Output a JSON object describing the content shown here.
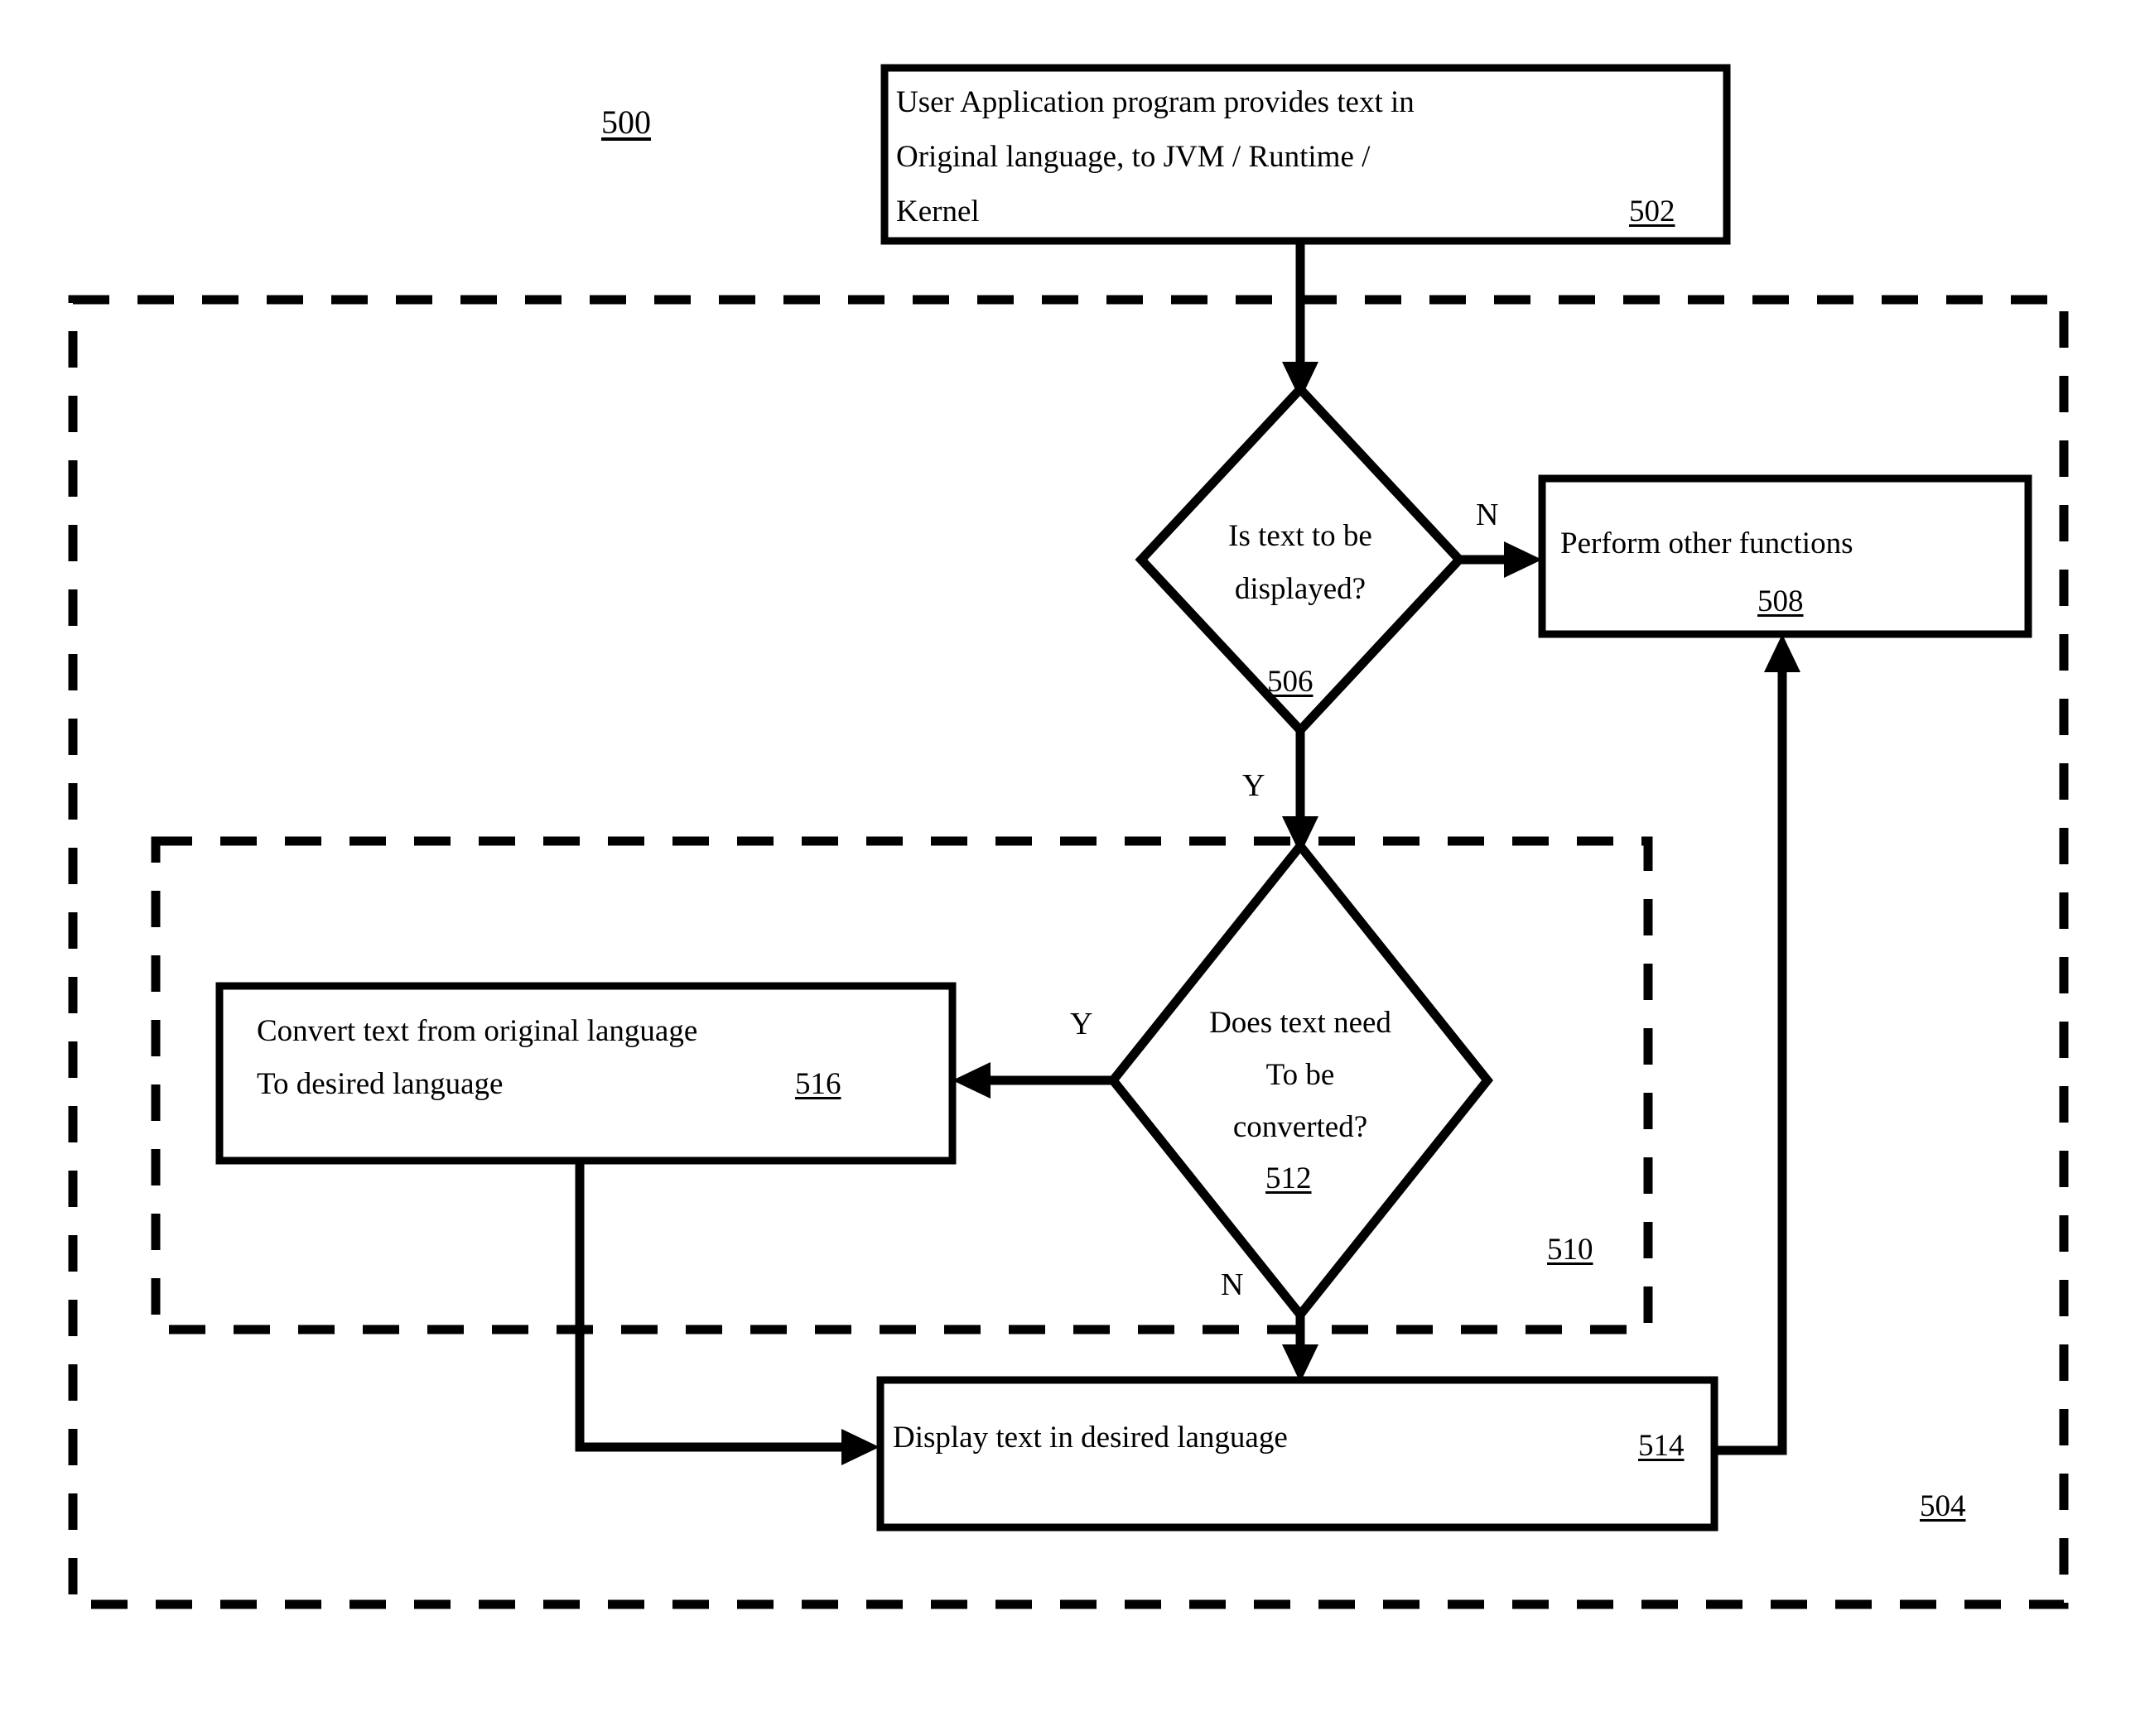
{
  "figure": {
    "id_label": "500",
    "outer_group_label": "504",
    "inner_group_label": "510"
  },
  "nodes": [
    {
      "key": "start",
      "type": "process",
      "ref": "502",
      "lines": [
        "User Application program provides text in",
        "Original language, to JVM / Runtime /",
        "Kernel"
      ]
    },
    {
      "key": "decision_display",
      "type": "decision",
      "ref": "506",
      "lines": [
        "Is text to be",
        "displayed?"
      ]
    },
    {
      "key": "other_functions",
      "type": "process",
      "ref": "508",
      "lines": [
        "Perform other functions"
      ]
    },
    {
      "key": "decision_convert",
      "type": "decision",
      "ref": "512",
      "lines": [
        "Does text need",
        "To be",
        "converted?"
      ]
    },
    {
      "key": "convert_text",
      "type": "process",
      "ref": "516",
      "lines": [
        "Convert text from original language",
        "To desired language"
      ]
    },
    {
      "key": "display_text",
      "type": "process",
      "ref": "514",
      "lines": [
        "Display text in desired language"
      ]
    }
  ],
  "edge_labels": {
    "display_no": "N",
    "display_yes": "Y",
    "convert_yes": "Y",
    "convert_no": "N"
  },
  "colors": {
    "stroke": "#000000",
    "fill": "#ffffff",
    "background": "#ffffff"
  }
}
